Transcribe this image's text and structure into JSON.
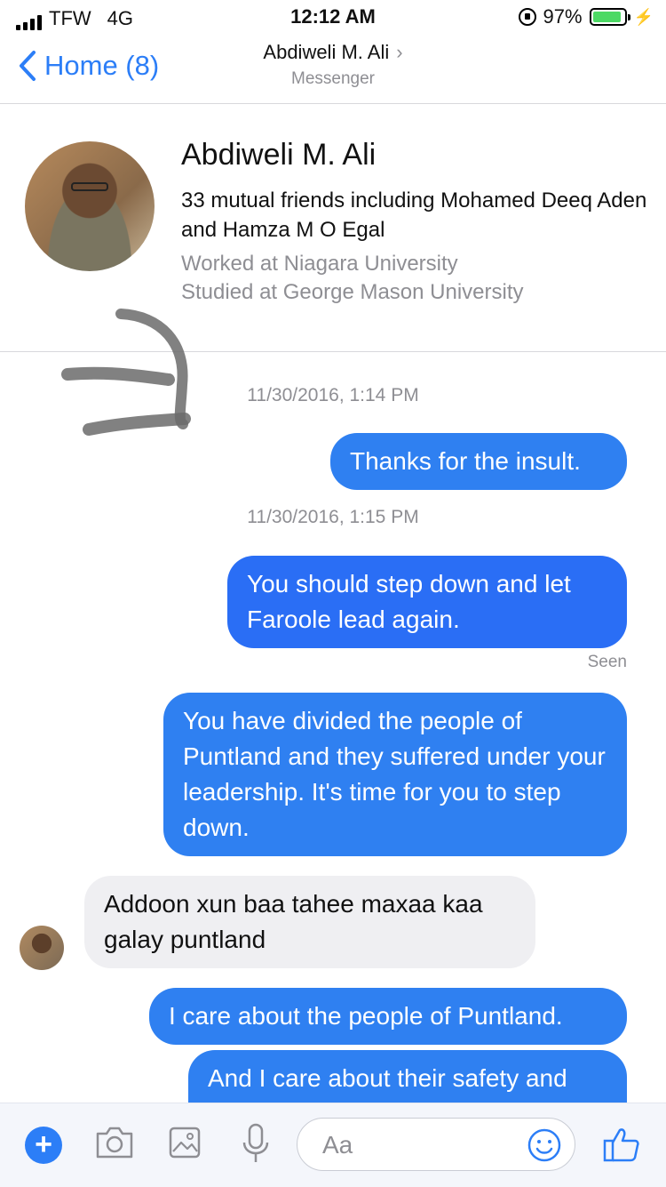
{
  "status_bar": {
    "carrier": "TFW",
    "network": "4G",
    "time": "12:12 AM",
    "battery": "97%",
    "battery_level": 0.97
  },
  "nav": {
    "back_label": "Home (8)",
    "title": "Abdiweli M. Ali",
    "subtitle": "Messenger"
  },
  "profile": {
    "name": "Abdiweli M. Ali",
    "mutual": "33 mutual friends including Mohamed Deeq Aden and Hamza M O Egal",
    "work": "Worked at Niagara University",
    "study": "Studied at George Mason University"
  },
  "messages": {
    "ts1": "11/30/2016, 1:14 PM",
    "m1": "Thanks for the insult.",
    "ts2": "11/30/2016, 1:15 PM",
    "m2": "You should step down and let Faroole lead again.",
    "seen": "Seen",
    "m3": "You have divided the people of Puntland and they suffered under your leadership. It's time for you to step down.",
    "m4": "Addoon xun baa tahee maxaa kaa galay puntland",
    "m5": "I care about the people of Puntland.",
    "m6": "And I care about their safety and"
  },
  "composer": {
    "placeholder": "Aa",
    "plus": "+"
  },
  "colors": {
    "accent": "#2c7ef7",
    "outgoing_bubble": "#2f80f1",
    "incoming_bubble": "#efeff2"
  }
}
